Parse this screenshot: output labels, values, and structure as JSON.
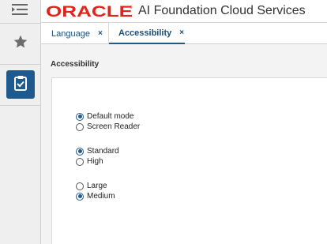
{
  "header": {
    "brand_logo_text": "ORACLE",
    "app_title": "AI Foundation Cloud Services",
    "brand_color": "#e2231a"
  },
  "sidebar": {
    "items": [
      {
        "icon": "menu-icon"
      },
      {
        "icon": "star-icon"
      },
      {
        "icon": "tasks-clipboard-icon",
        "active": true
      }
    ]
  },
  "tabs": [
    {
      "label": "Language",
      "close": "×"
    },
    {
      "label": "Accessibility",
      "close": "×",
      "active": true
    }
  ],
  "page": {
    "title": "Accessibility",
    "groups": [
      {
        "options": [
          {
            "label": "Default mode",
            "checked": true
          },
          {
            "label": "Screen Reader",
            "checked": false
          }
        ]
      },
      {
        "options": [
          {
            "label": "Standard",
            "checked": true
          },
          {
            "label": "High",
            "checked": false
          }
        ]
      },
      {
        "options": [
          {
            "label": "Large",
            "checked": false
          },
          {
            "label": "Medium",
            "checked": true
          }
        ]
      }
    ]
  },
  "colors": {
    "accent": "#1e5a8e",
    "rail_background": "#efefef"
  }
}
